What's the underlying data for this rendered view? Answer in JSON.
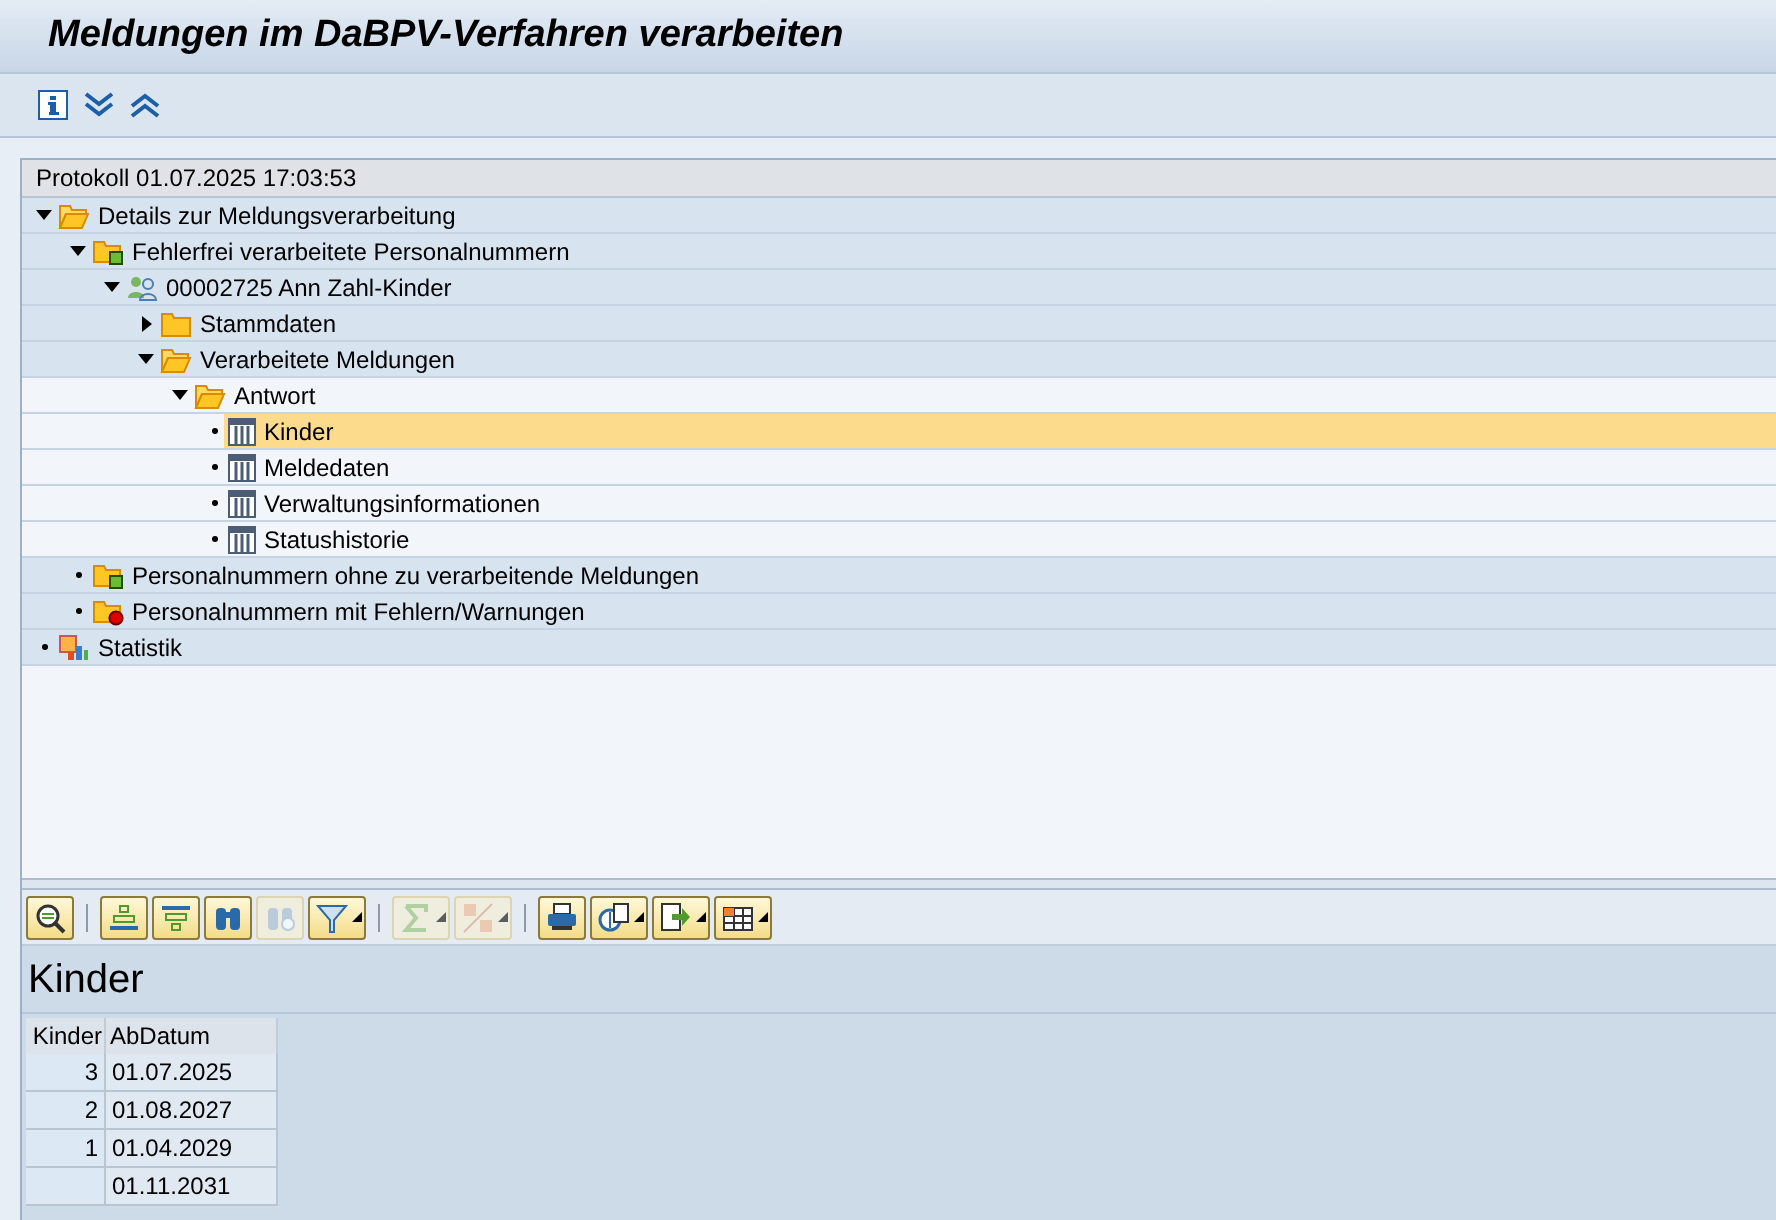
{
  "window": {
    "title": "Meldungen im DaBPV-Verfahren verarbeiten"
  },
  "toolbar": [
    {
      "kind": "info"
    },
    {
      "kind": "expand"
    },
    {
      "kind": "collapse"
    }
  ],
  "log": {
    "header": "Protokoll 01.07.2025 17:03:53",
    "tree": [
      {
        "label": "Details zur Meldungsverarbeitung",
        "kind": "folder-open",
        "expanded": true,
        "selected": false,
        "children": [
          {
            "label": "Fehlerfrei verarbeitete Personalnummern",
            "kind": "folder-ok",
            "expanded": true,
            "selected": false,
            "children": [
              {
                "label": "00002725 Ann Zahl-Kinder",
                "kind": "people",
                "expanded": true,
                "selected": false,
                "children": [
                  {
                    "label": "Stammdaten",
                    "kind": "folder",
                    "expanded": false,
                    "selected": false
                  },
                  {
                    "label": "Verarbeitete Meldungen",
                    "kind": "folder-open",
                    "expanded": true,
                    "selected": false,
                    "children": [
                      {
                        "label": "Antwort",
                        "kind": "folder-open",
                        "expanded": true,
                        "selected": false,
                        "children": [
                          {
                            "label": "Kinder",
                            "kind": "table",
                            "selected": true
                          },
                          {
                            "label": "Meldedaten",
                            "kind": "table",
                            "selected": false
                          },
                          {
                            "label": "Verwaltungsinformationen",
                            "kind": "table",
                            "selected": false
                          },
                          {
                            "label": "Statushistorie",
                            "kind": "table",
                            "selected": false
                          }
                        ]
                      }
                    ]
                  }
                ]
              }
            ]
          },
          {
            "label": "Personalnummern ohne zu verarbeitende Meldungen",
            "kind": "folder-ok",
            "selected": false
          },
          {
            "label": "Personalnummern mit Fehlern/Warnungen",
            "kind": "folder-error",
            "selected": false
          }
        ]
      },
      {
        "label": "Statistik",
        "kind": "chart",
        "selected": false
      }
    ]
  },
  "alv": {
    "toolbar": [
      [
        {
          "kind": "details",
          "disabled": false,
          "menu": false
        }
      ],
      [
        {
          "kind": "sort-asc",
          "disabled": false,
          "menu": false
        },
        {
          "kind": "sort-desc",
          "disabled": false,
          "menu": false
        },
        {
          "kind": "find",
          "disabled": false,
          "menu": false
        },
        {
          "kind": "find-next",
          "disabled": true,
          "menu": false
        },
        {
          "kind": "filter",
          "disabled": false,
          "menu": true
        }
      ],
      [
        {
          "kind": "sum",
          "disabled": true,
          "menu": true
        },
        {
          "kind": "subtotal",
          "disabled": true,
          "menu": true
        }
      ],
      [
        {
          "kind": "print",
          "disabled": false,
          "menu": false
        },
        {
          "kind": "views",
          "disabled": false,
          "menu": true
        },
        {
          "kind": "export",
          "disabled": false,
          "menu": true
        },
        {
          "kind": "layout",
          "disabled": false,
          "menu": true
        }
      ]
    ],
    "title": "Kinder",
    "columns": [
      "Kinder",
      "AbDatum"
    ],
    "rows": [
      [
        "3",
        "01.07.2025"
      ],
      [
        "2",
        "01.08.2027"
      ],
      [
        "1",
        "01.04.2029"
      ],
      [
        "",
        "01.11.2031"
      ]
    ]
  }
}
